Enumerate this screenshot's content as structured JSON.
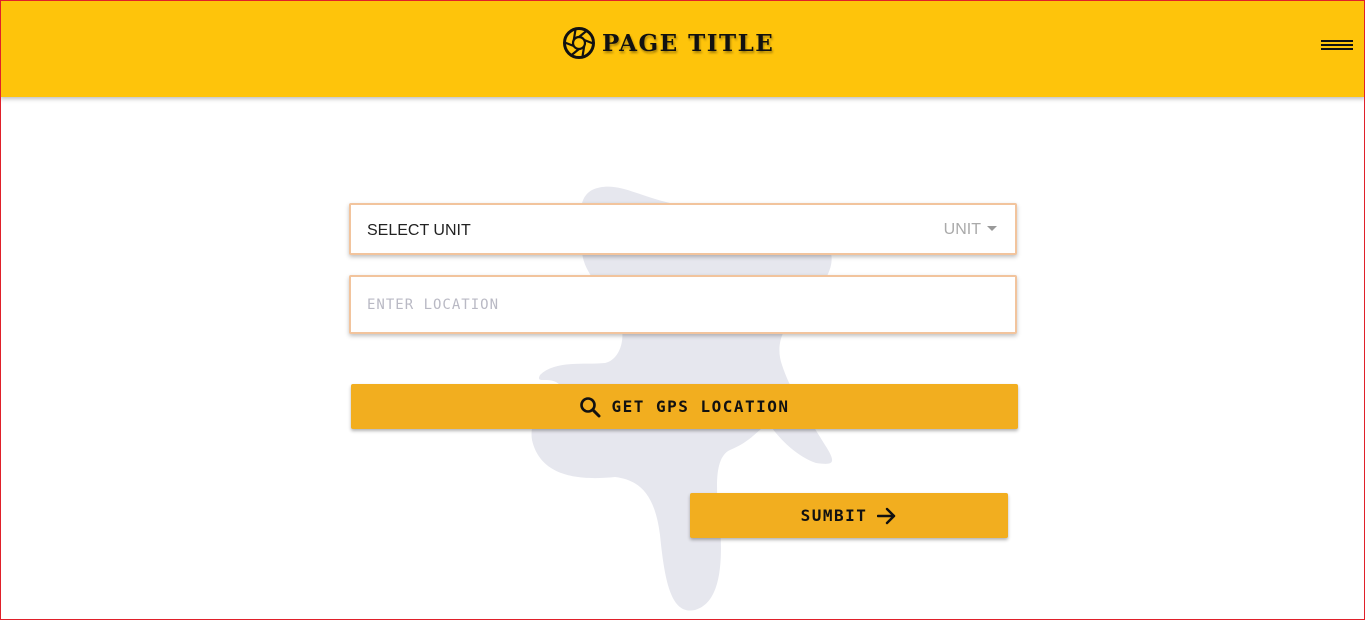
{
  "header": {
    "title": "PAGE TITLE",
    "logo_icon": "aperture-icon",
    "menu_icon": "hamburger-menu-icon",
    "background_color": "#fec40b"
  },
  "form": {
    "unit_label": "SELECT UNIT",
    "unit_select_value": "UNIT",
    "location_placeholder": "ENTER LOCATION",
    "location_value": "",
    "gps_button_label": "GET GPS LOCATION",
    "gps_button_icon": "search-icon",
    "submit_button_label": "SUMBIT",
    "submit_button_icon": "arrow-right-icon",
    "button_color": "#f2ae1f",
    "field_border_color": "#f2c49d"
  },
  "background": {
    "decoration_icon": "map-blob-icon",
    "decoration_color": "#e6e7ee"
  }
}
